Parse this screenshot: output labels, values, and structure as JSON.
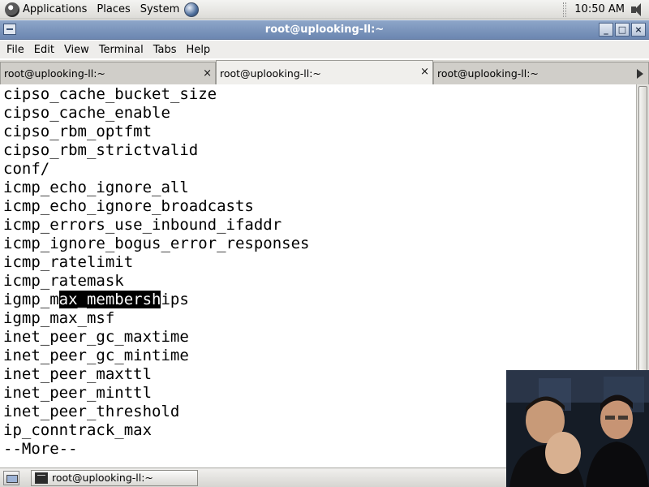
{
  "top_panel": {
    "menus": [
      "Applications",
      "Places",
      "System"
    ],
    "clock": "10:50 AM",
    "icons": [
      "gnome-foot-icon",
      "network-globe-icon",
      "volume-icon"
    ]
  },
  "window": {
    "title": "root@uplooking-ll:~",
    "buttons": [
      "_",
      "□",
      "×"
    ]
  },
  "menubar": {
    "items": [
      "File",
      "Edit",
      "View",
      "Terminal",
      "Tabs",
      "Help"
    ]
  },
  "tabs": [
    {
      "label": "root@uplooking-ll:~",
      "active": false
    },
    {
      "label": "root@uplooking-ll:~",
      "active": true
    },
    {
      "label": "root@uplooking-ll:~",
      "active": false
    }
  ],
  "tab_close_symbol": "×",
  "terminal": {
    "lines": [
      "cipso_cache_bucket_size",
      "cipso_cache_enable",
      "cipso_rbm_optfmt",
      "cipso_rbm_strictvalid",
      "conf/",
      "icmp_echo_ignore_all",
      "icmp_echo_ignore_broadcasts",
      "icmp_errors_use_inbound_ifaddr",
      "icmp_ignore_bogus_error_responses",
      "icmp_ratelimit",
      "icmp_ratemask",
      "igmp_max_memberships",
      "igmp_max_msf",
      "inet_peer_gc_maxtime",
      "inet_peer_gc_mintime",
      "inet_peer_maxttl",
      "inet_peer_minttl",
      "inet_peer_threshold",
      "ip_conntrack_max",
      "--More--"
    ],
    "selected_line": {
      "before": "igmp_m",
      "selected": "ax_membersh",
      "after": "ips"
    }
  },
  "taskbar": {
    "task_label": "root@uplooking-ll:~"
  },
  "colors": {
    "title_bar": "#7b94bd",
    "selection_bg": "#000000",
    "terminal_bg": "#ffffff"
  }
}
